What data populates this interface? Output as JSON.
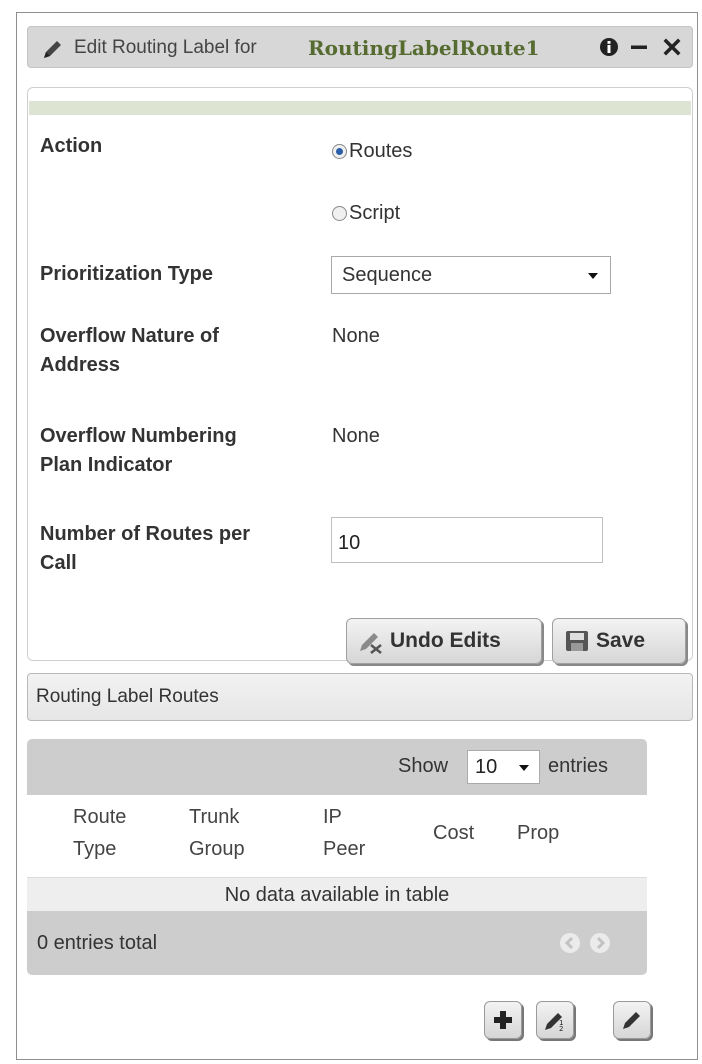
{
  "window": {
    "title_prefix": "Edit Routing Label for",
    "title_name": "RoutingLabelRoute1",
    "icons": [
      "pencil-icon",
      "info-icon",
      "minimize-icon",
      "close-icon"
    ]
  },
  "form": {
    "action": {
      "label": "Action",
      "options": [
        {
          "label": "Routes",
          "selected": true
        },
        {
          "label": "Script",
          "selected": false
        }
      ]
    },
    "prioritization": {
      "label": "Prioritization Type",
      "value": "Sequence"
    },
    "overflow_noa": {
      "label_line1": "Overflow Nature of",
      "label_line2": "Address",
      "value": "None"
    },
    "overflow_npi": {
      "label_line1": "Overflow Numbering",
      "label_line2": "Plan Indicator",
      "value": "None"
    },
    "routes_per_call": {
      "label_line1": "Number of Routes per",
      "label_line2": "Call",
      "value": "10"
    },
    "undo_label": "Undo Edits",
    "save_label": "Save"
  },
  "routes_section": {
    "title": "Routing Label Routes",
    "show_label": "Show",
    "page_length": "10",
    "entries_label": "entries",
    "columns": [
      {
        "line1": "Route",
        "line2": "Type"
      },
      {
        "line1": "Trunk",
        "line2": "Group"
      },
      {
        "line1": "IP",
        "line2": "Peer"
      },
      {
        "line1": "Cost",
        "line2": ""
      },
      {
        "line1": "Prop",
        "line2": ""
      }
    ],
    "empty_message": "No data available in table",
    "info": "0 entries total"
  },
  "colors": {
    "title_name": "#556b2f",
    "form_bar": "#dde5d2",
    "table_bar": "#cdcdcd"
  }
}
